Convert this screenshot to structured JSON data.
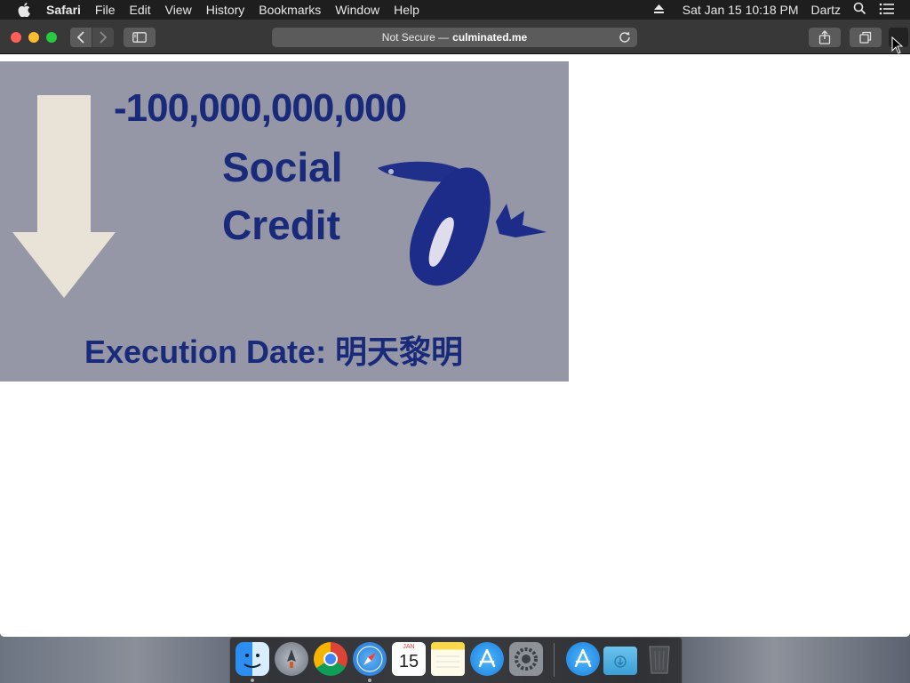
{
  "menubar": {
    "app_name": "Safari",
    "items": [
      "File",
      "Edit",
      "View",
      "History",
      "Bookmarks",
      "Window",
      "Help"
    ],
    "datetime": "Sat Jan 15  10:18 PM",
    "user": "Dartz",
    "icons": [
      "apple-icon",
      "eject-icon",
      "search-icon",
      "list-icon"
    ]
  },
  "toolbar": {
    "security_label": "Not Secure —",
    "url": "culminated.me",
    "buttons": [
      "back-icon",
      "forward-icon",
      "sidebar-icon",
      "reload-icon",
      "share-icon",
      "tabs-icon"
    ]
  },
  "banner": {
    "amount": "-100,000,000,000",
    "line1": "Social",
    "line2": "Credit",
    "execution": "Execution Date: 明天黎明"
  },
  "dock": {
    "apps": [
      "finder-icon",
      "launchpad-icon",
      "chrome-icon",
      "safari-icon",
      "calendar-icon",
      "notes-icon",
      "app-store-icon",
      "system-preferences-icon",
      "app-store-download-icon",
      "downloads-folder-icon",
      "trash-icon"
    ],
    "calendar_month": "JAN",
    "calendar_day": "15"
  },
  "colors": {
    "banner_bg": "#9597a6",
    "banner_text": "#1a2a7a"
  }
}
